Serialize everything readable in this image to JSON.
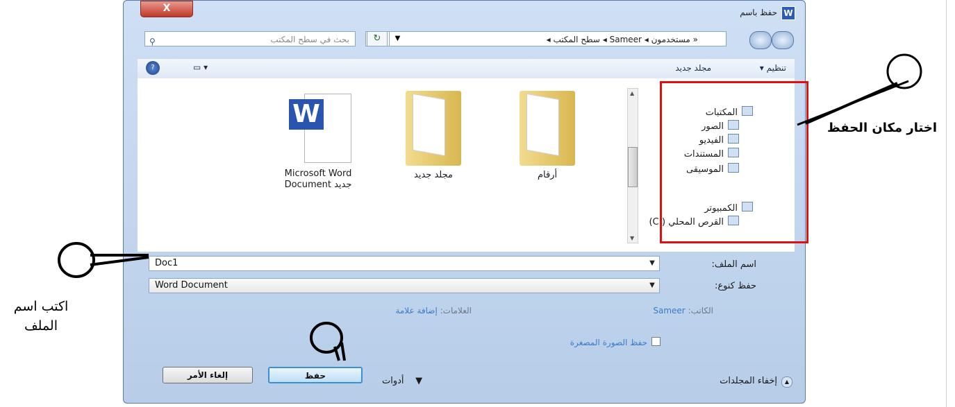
{
  "window": {
    "title": "حفظ باسم",
    "app_icon_letter": "W",
    "close_symbol": "X"
  },
  "address_bar": {
    "path": "« مستخدمون ◂ Sameer ◂ سطح المكتب ◂",
    "refresh_symbol": "↻"
  },
  "search": {
    "placeholder": "بحث في سطح المكتب"
  },
  "toolbar": {
    "organize_label": "تنظيم ▾",
    "new_folder_label": "مجلد جديد"
  },
  "nav_pane": {
    "items": [
      {
        "label": "المكتبات",
        "icon": "library-icon"
      },
      {
        "label": "الصور",
        "icon": "pictures-icon"
      },
      {
        "label": "الفيديو",
        "icon": "video-icon"
      },
      {
        "label": "المستندات",
        "icon": "documents-icon"
      },
      {
        "label": "الموسيقى",
        "icon": "music-icon"
      },
      {
        "label": "الكمبيوتر",
        "icon": "computer-icon"
      },
      {
        "label": "القرص المحلي (:C)",
        "icon": "drive-icon"
      }
    ]
  },
  "files": [
    {
      "label": "أرقام",
      "type": "folder"
    },
    {
      "label": "مجلد جديد",
      "type": "folder"
    },
    {
      "label": "Microsoft Word\nDocument جديد",
      "type": "word-document"
    }
  ],
  "form": {
    "filename_label": "اسم الملف:",
    "filename_value": "Doc1",
    "savetype_label": "حفظ كنوع:",
    "savetype_value": "Word Document",
    "authors_label": "الكاتب:",
    "authors_value": "Sameer",
    "tags_label": "العلامات:",
    "tags_value": "إضافة علامة",
    "thumbnail_label": "حفظ الصورة المصغرة",
    "hide_folders_label": "إخفاء المجلدات",
    "tools_label": "أدوات",
    "save_label": "حفظ",
    "cancel_label": "إلغاء الأمر"
  },
  "annotations": {
    "location_note": "اختار مكان الحفظ",
    "filename_note_line1": "اكتب اسم",
    "filename_note_line2": "الملف"
  }
}
